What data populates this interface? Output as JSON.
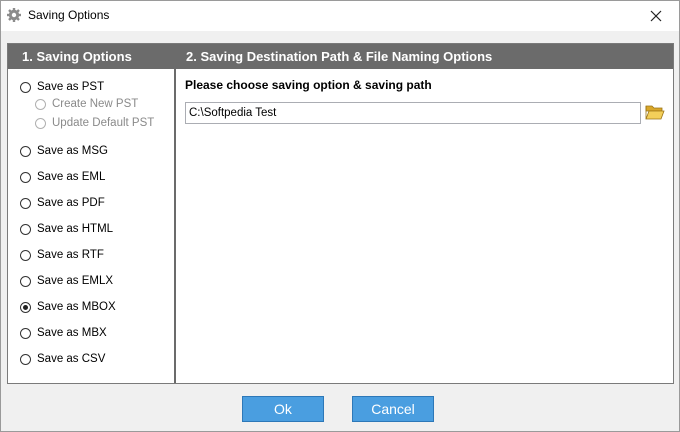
{
  "window": {
    "title": "Saving Options"
  },
  "sections": {
    "left_header": "1. Saving Options",
    "right_header": "2. Saving Destination Path & File Naming Options"
  },
  "options": [
    {
      "label": "Save as PST",
      "checked": false
    },
    {
      "label": "Create New PST",
      "checked": false,
      "sub": true,
      "enabled": false
    },
    {
      "label": "Update Default PST",
      "checked": false,
      "sub": true,
      "enabled": false
    },
    {
      "label": "Save as MSG",
      "checked": false
    },
    {
      "label": "Save as EML",
      "checked": false
    },
    {
      "label": "Save as PDF",
      "checked": false
    },
    {
      "label": "Save as HTML",
      "checked": false
    },
    {
      "label": "Save as RTF",
      "checked": false
    },
    {
      "label": "Save as EMLX",
      "checked": false
    },
    {
      "label": "Save as MBOX",
      "checked": true
    },
    {
      "label": "Save as MBX",
      "checked": false
    },
    {
      "label": "Save as CSV",
      "checked": false
    }
  ],
  "destination": {
    "label": "Please choose saving option & saving path",
    "path": "C:\\Softpedia Test",
    "browse_icon": "folder-open-icon"
  },
  "buttons": {
    "ok": "Ok",
    "cancel": "Cancel"
  },
  "colors": {
    "header_bg": "#6b6b6b",
    "button_bg": "#4a9ee0",
    "button_border": "#2d78b8"
  }
}
